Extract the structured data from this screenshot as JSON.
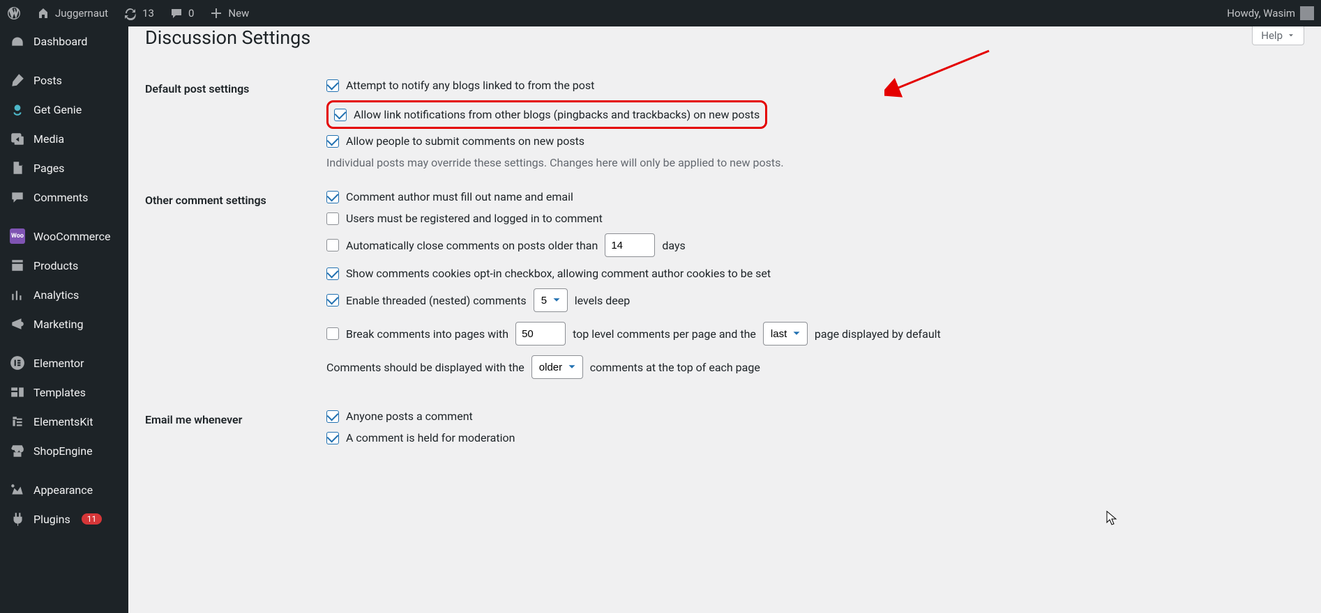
{
  "adminbar": {
    "site_name": "Juggernaut",
    "updates_count": "13",
    "comments_count": "0",
    "new_label": "New",
    "howdy": "Howdy, Wasim"
  },
  "menu": {
    "dashboard": "Dashboard",
    "posts": "Posts",
    "get_genie": "Get Genie",
    "media": "Media",
    "pages": "Pages",
    "comments": "Comments",
    "woocommerce": "WooCommerce",
    "products": "Products",
    "analytics": "Analytics",
    "marketing": "Marketing",
    "elementor": "Elementor",
    "templates": "Templates",
    "elementskit": "ElementsKit",
    "shopengine": "ShopEngine",
    "appearance": "Appearance",
    "plugins": "Plugins",
    "plugins_badge": "11"
  },
  "help": {
    "label": "Help"
  },
  "page_title": "Discussion Settings",
  "sections": {
    "default_post": {
      "heading": "Default post settings",
      "opt1": "Attempt to notify any blogs linked to from the post",
      "opt2": "Allow link notifications from other blogs (pingbacks and trackbacks) on new posts",
      "opt3": "Allow people to submit comments on new posts",
      "note": "Individual posts may override these settings. Changes here will only be applied to new posts."
    },
    "other_comment": {
      "heading": "Other comment settings",
      "opt1": "Comment author must fill out name and email",
      "opt2": "Users must be registered and logged in to comment",
      "opt3_pre": "Automatically close comments on posts older than",
      "opt3_days": "14",
      "opt3_post": "days",
      "opt4": "Show comments cookies opt-in checkbox, allowing comment author cookies to be set",
      "opt5_pre": "Enable threaded (nested) comments",
      "opt5_levels": "5",
      "opt5_post": "levels deep",
      "opt6_pre": "Break comments into pages with",
      "opt6_val": "50",
      "opt6_mid": "top level comments per page and the",
      "opt6_sel": "last",
      "opt6_post": "page displayed by default",
      "opt7_pre": "Comments should be displayed with the",
      "opt7_sel": "older",
      "opt7_post": "comments at the top of each page"
    },
    "email": {
      "heading": "Email me whenever",
      "opt1": "Anyone posts a comment",
      "opt2": "A comment is held for moderation"
    }
  }
}
